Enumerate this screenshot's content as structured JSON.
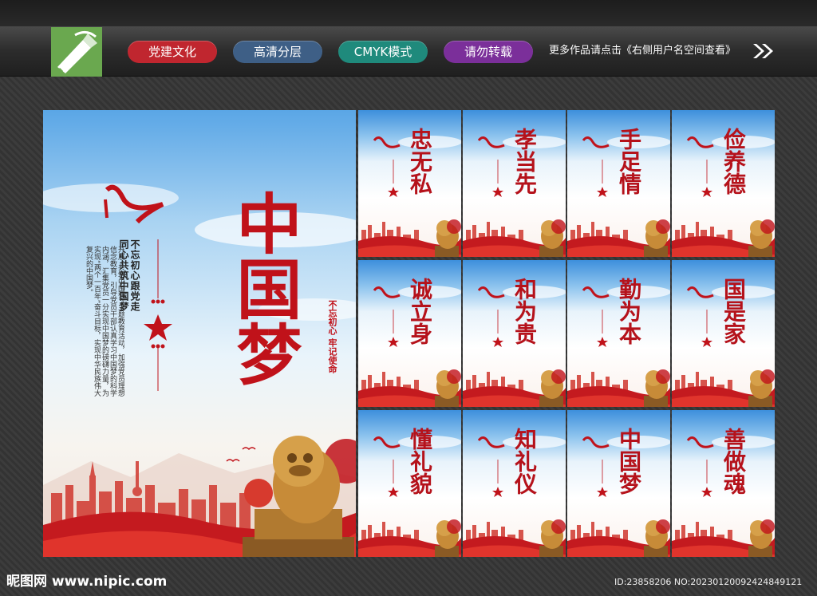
{
  "tags": [
    {
      "label": "党建文化",
      "color": "#c0262f"
    },
    {
      "label": "高清分层",
      "color": "#3e5f86"
    },
    {
      "label": "CMYK模式",
      "color": "#1f8a7c"
    },
    {
      "label": "请勿转载",
      "color": "#7b2f9a"
    }
  ],
  "tagline": "更多作品请点击《右侧用户名空间查看》",
  "poster": {
    "title": "中国梦",
    "slogan_1": "不忘初心跟党走",
    "slogan_2": "同心共筑中国梦",
    "body": "开展“共筑中国梦”主题教育活动，加强党员理想信念教育，引导党员干部认真学习中国梦的科学内涵，汇集党员一分实现中国梦的磅礴力量，为实现“两个一百年”奋斗目标，实现中华民族伟大复兴的中国梦。",
    "seal_1": "不忘初心",
    "seal_2": "牢记使命"
  },
  "cards": [
    {
      "title": "忠无私"
    },
    {
      "title": "孝当先"
    },
    {
      "title": "手足情"
    },
    {
      "title": "俭养德"
    },
    {
      "title": "诚立身"
    },
    {
      "title": "和为贵"
    },
    {
      "title": "勤为本"
    },
    {
      "title": "国是家"
    },
    {
      "title": "懂礼貌"
    },
    {
      "title": "知礼仪"
    },
    {
      "title": "中国梦"
    },
    {
      "title": "善做魂"
    }
  ],
  "footer": {
    "site": "昵图网 www.nipic.com",
    "id": "ID:23858206 NO:20230120092424849121"
  },
  "colors": {
    "red": "#c0121a",
    "sky": "#5aa6e6"
  }
}
